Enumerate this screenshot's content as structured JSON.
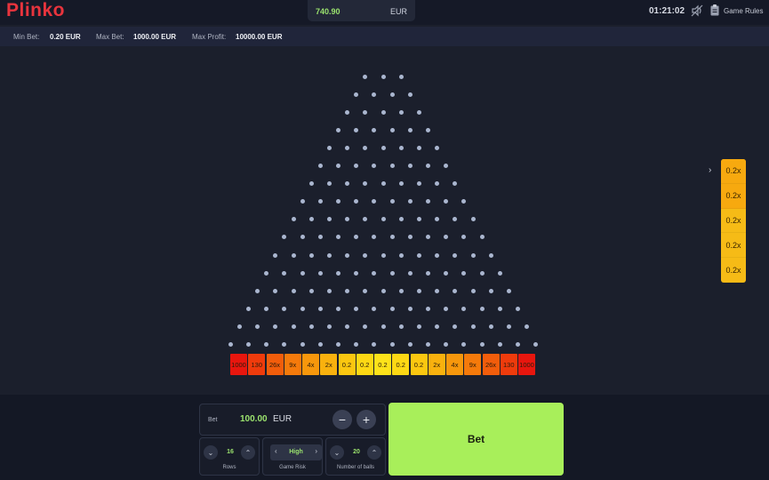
{
  "header": {
    "logo": "Plinko",
    "balance_amount": "740.90",
    "balance_currency": "EUR",
    "clock": "01:21:02",
    "rules_label": "Game Rules"
  },
  "limits": {
    "min_bet_label": "Min Bet:",
    "min_bet_value": "0.20 EUR",
    "max_bet_label": "Max Bet:",
    "max_bet_value": "1000.00 EUR",
    "max_profit_label": "Max Profit:",
    "max_profit_value": "10000.00 EUR"
  },
  "board": {
    "rows": 16,
    "peg_color": "#aab6cf",
    "multipliers": [
      "1000",
      "130",
      "26x",
      "9x",
      "4x",
      "2x",
      "0.2",
      "0.2",
      "0.2",
      "0.2",
      "0.2",
      "2x",
      "4x",
      "9x",
      "26x",
      "130",
      "1000"
    ],
    "slot_colors": [
      "#e8160e",
      "#ef3b0c",
      "#f25d0b",
      "#f57a0b",
      "#f7970c",
      "#f9b10e",
      "#fbc710",
      "#fdd814",
      "#fde21a",
      "#fdd814",
      "#fbc710",
      "#f9b10e",
      "#f7970c",
      "#f57a0b",
      "#f25d0b",
      "#ef3b0c",
      "#e8160e"
    ]
  },
  "history": {
    "items": [
      "0.2x",
      "0.2x",
      "0.2x",
      "0.2x",
      "0.2x"
    ]
  },
  "controls": {
    "bet_label": "Bet",
    "bet_amount": "100.00",
    "bet_currency": "EUR",
    "minus": "−",
    "plus": "+",
    "rows_value": "16",
    "rows_label": "Rows",
    "risk_value": "High",
    "risk_label": "Game Risk",
    "balls_value": "20",
    "balls_label": "Number of balls",
    "bet_button": "Bet"
  }
}
